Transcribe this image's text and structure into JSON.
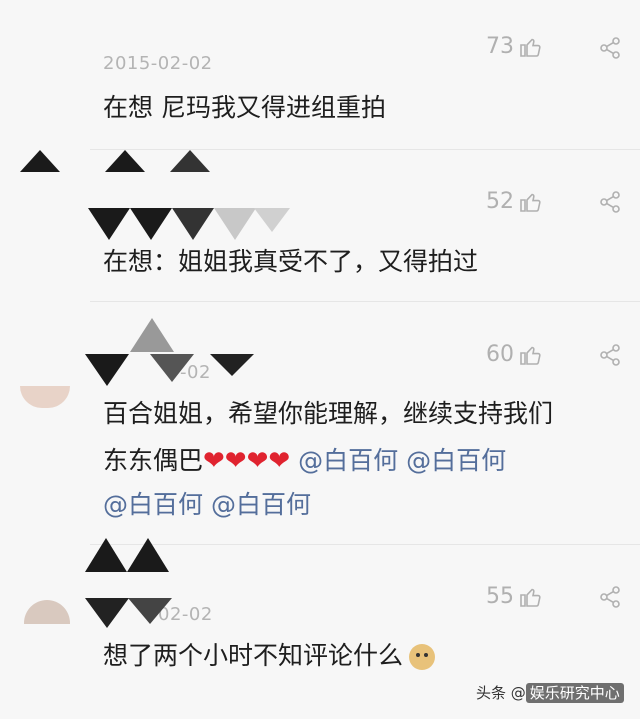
{
  "comments": [
    {
      "date": "2015-02-02",
      "likes": "73",
      "text": "在想 尼玛我又得进组重拍"
    },
    {
      "date": "",
      "likes": "52",
      "text": "在想：姐姐我真受不了，又得拍过"
    },
    {
      "date": "-02",
      "likes": "60",
      "text_line1": "百合姐姐，希望你能理解，继续支持我们",
      "text_line2_prefix": "东东偶巴",
      "hearts": "❤❤❤❤",
      "mentions": [
        "@白百何",
        "@白百何",
        "@白百何",
        "@白百何"
      ]
    },
    {
      "date": "02-02",
      "likes": "55",
      "text": "想了两个小时不知评论什么"
    }
  ],
  "icons": {
    "like": "thumbs-up-icon",
    "share": "share-icon",
    "emoji": "doge-emoji-icon"
  },
  "watermark": {
    "prefix": "头条 @",
    "brand": "娱乐研究中心"
  },
  "colors": {
    "mention": "#546e9b",
    "heart": "#e0232f",
    "meta": "#b0b0b0"
  }
}
